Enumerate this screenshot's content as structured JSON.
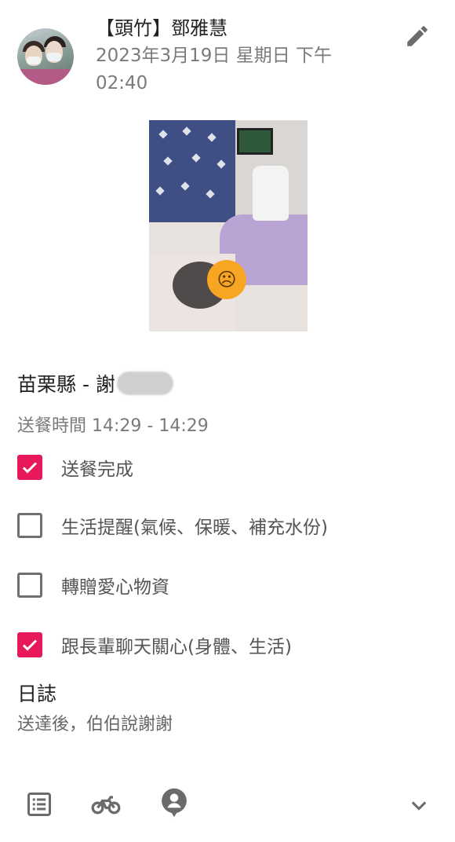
{
  "author": {
    "name": "【頭竹】鄧雅慧",
    "post_time": "2023年3月19日 星期日 下午 02:40",
    "avatar_icon": "avatar-photo"
  },
  "header": {
    "edit_icon": "pencil-icon"
  },
  "photo": {
    "alt": "photo-attachment"
  },
  "client": {
    "label": "苗栗縣 - 謝"
  },
  "delivery": {
    "time_text": "送餐時間 14:29 - 14:29"
  },
  "tasks": [
    {
      "label": "送餐完成",
      "checked": true
    },
    {
      "label": "生活提醒(氣候、保暖、補充水份)",
      "checked": false
    },
    {
      "label": "轉贈愛心物資",
      "checked": false
    },
    {
      "label": "跟長輩聊天關心(身體、生活)",
      "checked": true
    }
  ],
  "log": {
    "title": "日誌",
    "text": "送達後，伯伯說謝謝"
  },
  "toolbar": {
    "icons": [
      "list-icon",
      "motorcycle-icon",
      "location-person-icon",
      "chevron-down-icon"
    ]
  },
  "colors": {
    "accent": "#e8195a",
    "icon_gray": "#6b6b6b",
    "secondary_text": "#7a7a7a"
  }
}
